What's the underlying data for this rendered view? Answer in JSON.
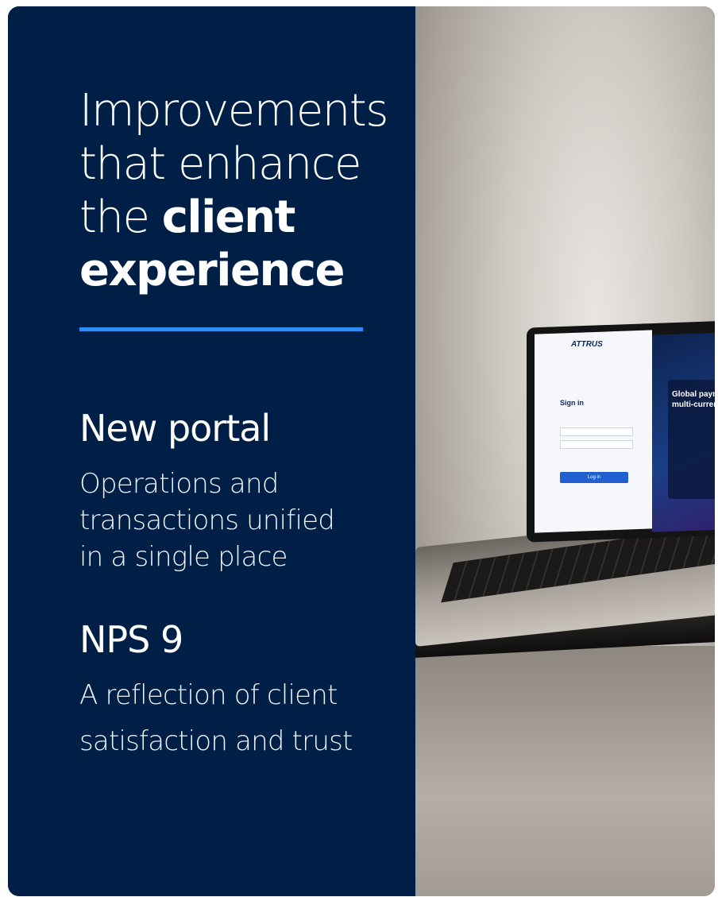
{
  "headline": {
    "line1": "Improvements",
    "line2": "that enhance",
    "line3_prefix": "the ",
    "line3_bold": "client",
    "line4_bold": "experience"
  },
  "stats": [
    {
      "title": "New portal",
      "lines": [
        "Operations and",
        "transactions unified",
        "in a single place"
      ]
    },
    {
      "title": "NPS 9",
      "lines": [
        "A reflection of client",
        "satisfaction and trust"
      ]
    }
  ],
  "laptop_screen": {
    "logo": "ATTRUS",
    "signin": "Sign in",
    "login_button": "Log in",
    "panel_title_1": "Global paym",
    "panel_title_2": "multi-curren"
  },
  "colors": {
    "panel_bg": "#001f47",
    "accent": "#2f8cf5",
    "text": "#ffffff"
  }
}
